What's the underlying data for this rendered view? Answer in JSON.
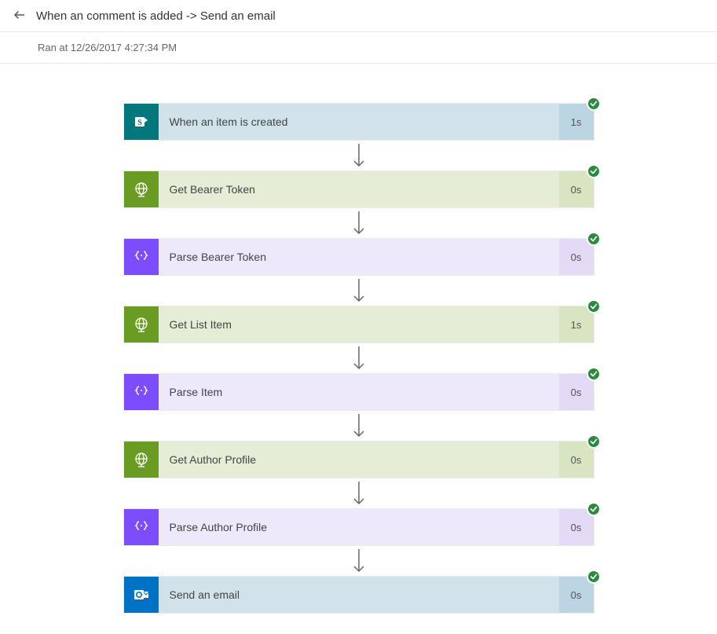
{
  "header": {
    "title": "When an comment is added -> Send an email"
  },
  "subheader": {
    "ran_at_text": "Ran at 12/26/2017 4:27:34 PM"
  },
  "steps": [
    {
      "label": "When an item is created",
      "duration": "1s",
      "theme": "sharepoint",
      "icon": "sharepoint",
      "status": "success"
    },
    {
      "label": "Get Bearer Token",
      "duration": "0s",
      "theme": "http",
      "icon": "globe",
      "status": "success"
    },
    {
      "label": "Parse Bearer Token",
      "duration": "0s",
      "theme": "parse",
      "icon": "braces",
      "status": "success"
    },
    {
      "label": "Get List Item",
      "duration": "1s",
      "theme": "http",
      "icon": "globe",
      "status": "success"
    },
    {
      "label": "Parse Item",
      "duration": "0s",
      "theme": "parse",
      "icon": "braces",
      "status": "success"
    },
    {
      "label": "Get Author Profile",
      "duration": "0s",
      "theme": "http",
      "icon": "globe",
      "status": "success"
    },
    {
      "label": "Parse Author Profile",
      "duration": "0s",
      "theme": "parse",
      "icon": "braces",
      "status": "success"
    },
    {
      "label": "Send an email",
      "duration": "0s",
      "theme": "outlook",
      "icon": "outlook",
      "status": "success"
    }
  ]
}
